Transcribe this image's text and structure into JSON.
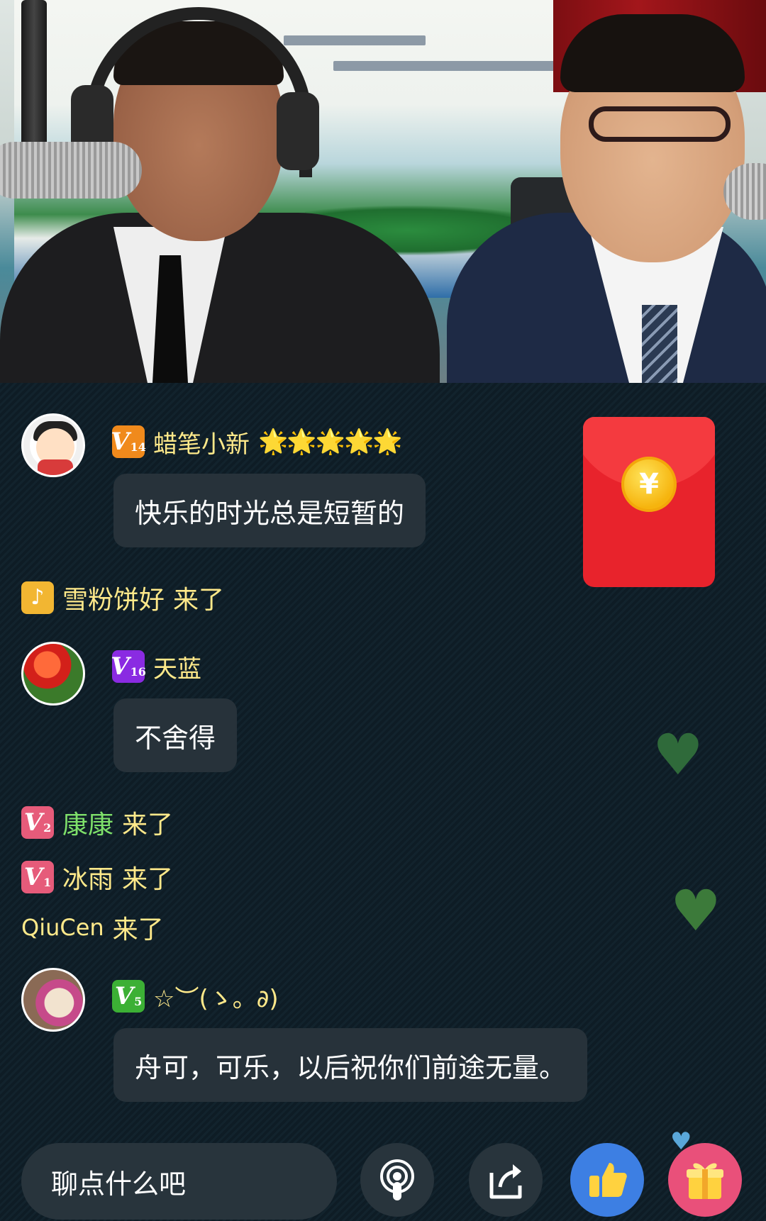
{
  "chat": {
    "messages": [
      {
        "type": "comment",
        "avatar_icon": "crayon-shinchan-avatar",
        "level": "14",
        "level_color": "#f08a1c",
        "name": "蜡笔小新",
        "name_decoration": "🌟🌟🌟🌟🌟",
        "text": "快乐的时光总是短暂的"
      },
      {
        "type": "arrival",
        "badge_icon": "music-note-badge",
        "name": "雪粉饼好",
        "action": "来了"
      },
      {
        "type": "comment",
        "avatar_icon": "red-tulip-avatar",
        "level": "16",
        "level_color": "#8a2be2",
        "name": "天蓝",
        "text": "不舍得"
      },
      {
        "type": "arrival",
        "level": "2",
        "level_color": "#e65b7a",
        "name": "康康",
        "name_color": "#7ee06a",
        "action": "来了"
      },
      {
        "type": "arrival",
        "level": "1",
        "level_color": "#e65b7a",
        "name": "冰雨",
        "action": "来了"
      },
      {
        "type": "arrival",
        "name": "QiuCen",
        "action": "来了"
      },
      {
        "type": "comment",
        "avatar_icon": "plush-bunny-avatar",
        "level": "5",
        "level_color": "#3cb035",
        "name": "☆︶(ゝ。∂)",
        "text": "舟可，可乐，以后祝你们前途无量。"
      }
    ]
  },
  "red_packet": {
    "symbol": "¥",
    "color": "#e8232c"
  },
  "bottom_bar": {
    "input_placeholder": "聊点什么吧",
    "mic_icon": "podcast-mic-icon",
    "share_icon": "share-icon",
    "like_icon": "thumbs-up-icon",
    "gift_icon": "gift-icon"
  },
  "level_prefix": "V"
}
